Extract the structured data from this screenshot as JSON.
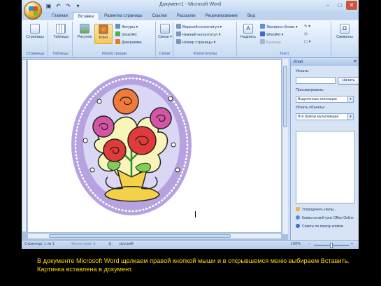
{
  "window": {
    "title": "Документ1 - Microsoft Word",
    "controls": [
      "–",
      "□",
      "✕"
    ]
  },
  "qat_icons": [
    "save-icon",
    "undo-icon",
    "redo-icon"
  ],
  "tabs": [
    {
      "label": "Главная",
      "active": false
    },
    {
      "label": "Вставка",
      "active": true
    },
    {
      "label": "Разметка страницы",
      "active": false
    },
    {
      "label": "Ссылки",
      "active": false
    },
    {
      "label": "Рассылки",
      "active": false
    },
    {
      "label": "Рецензирование",
      "active": false
    },
    {
      "label": "Вид",
      "active": false
    }
  ],
  "ribbon": {
    "pages": {
      "label": "Страницы",
      "group": "Страницы"
    },
    "table": {
      "label": "Таблица",
      "group": "Таблицы"
    },
    "picture": {
      "label": "Рисунок"
    },
    "clip": {
      "label": "Клип"
    },
    "shapes": "Фигуры",
    "smartart": "SmartArt",
    "chart": "Диаграмма",
    "illustrations_group": "Иллюстрации",
    "links": {
      "label": "Связи",
      "group": "Связи"
    },
    "header": "Верхний колонтитул",
    "footer": "Нижний колонтитул",
    "page_number": "Номер страницы",
    "header_group": "Колонтитулы",
    "textbox": {
      "label": "Надпись"
    },
    "quickparts": "Экспресс-блоки",
    "wordart": "WordArt",
    "dropcap": "Буквица",
    "text_group": "Текст",
    "symbols": {
      "label": "Символы"
    }
  },
  "pane": {
    "title": "Клип",
    "search_label": "Искать:",
    "search_value": "",
    "go": "Начать",
    "browse_label": "Просматривать:",
    "browse_value": "Выделенные коллекции",
    "types_label": "Искать объекты:",
    "types_value": "Все файлы мультимедиа",
    "links": [
      "Упорядочить клипы...",
      "Клипы на веб-узле Office Online",
      "Советы по поиску клипов"
    ]
  },
  "status": {
    "page": "Страница: 1 из 1",
    "words": "Число слов: 0",
    "lang": "русский",
    "zoom": "100%",
    "zoom_fraction": 0.5
  },
  "caption": "В документе Microsoft Word щелкаем правой кнопкой мыши и в открывшемся меню выбираем Вставить. Картинка вставлена в документ.",
  "colors": {
    "ribbon_bg": "#d7e6f8",
    "selected": "#f7c75a",
    "caption": "#ffd700",
    "clipart_frame": "#b7a2e0"
  }
}
